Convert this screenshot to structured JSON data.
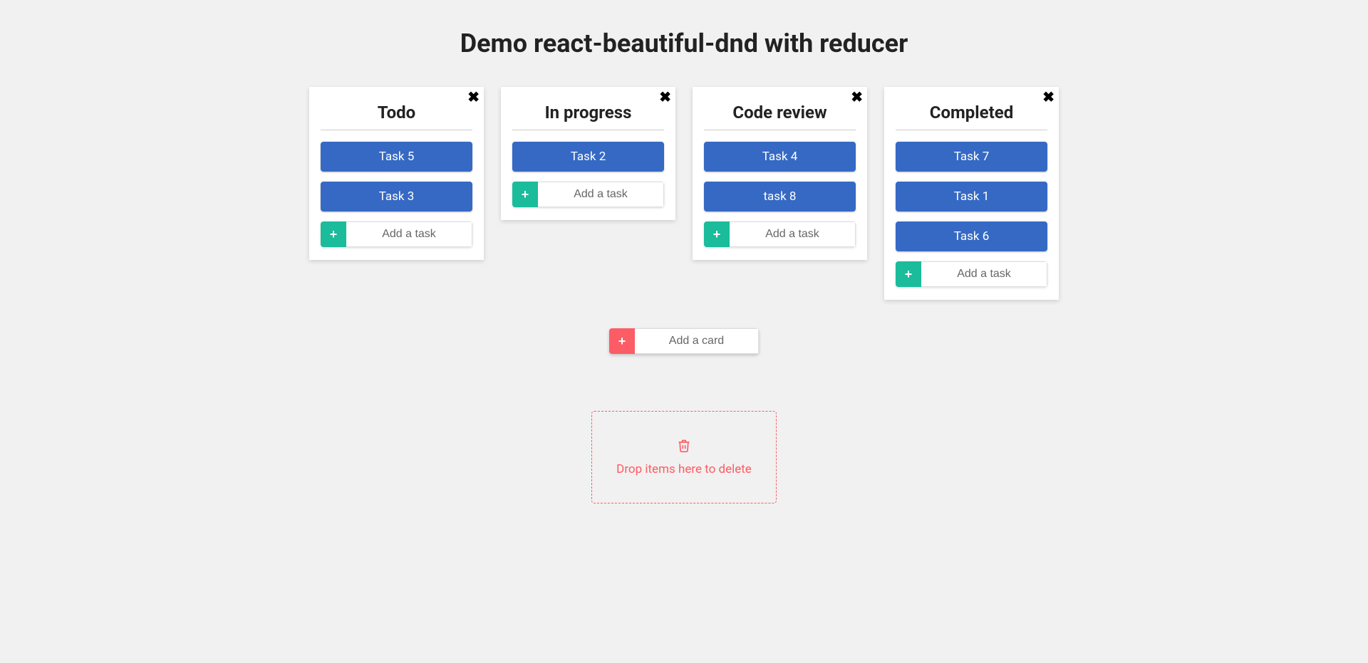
{
  "page_title": "Demo react-beautiful-dnd with reducer",
  "add_task_placeholder": "Add a task",
  "add_card_placeholder": "Add a card",
  "delete_zone_text": "Drop items here to delete",
  "columns": [
    {
      "title": "Todo",
      "tasks": [
        "Task 5",
        "Task 3"
      ]
    },
    {
      "title": "In progress",
      "tasks": [
        "Task 2"
      ]
    },
    {
      "title": "Code review",
      "tasks": [
        "Task 4",
        "task 8"
      ]
    },
    {
      "title": "Completed",
      "tasks": [
        "Task 7",
        "Task 1",
        "Task 6"
      ]
    }
  ]
}
